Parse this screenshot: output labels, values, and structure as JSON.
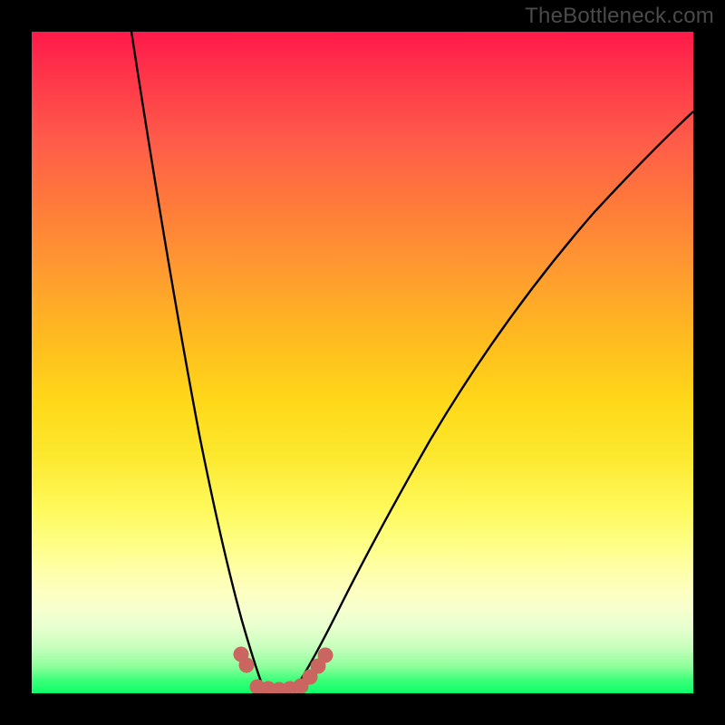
{
  "watermark": "TheBottleneck.com",
  "chart_data": {
    "type": "line",
    "title": "",
    "xlabel": "",
    "ylabel": "",
    "xlim": [
      0,
      100
    ],
    "ylim": [
      0,
      100
    ],
    "series": [
      {
        "name": "left-curve",
        "x": [
          15,
          17,
          19,
          21,
          23,
          25,
          27,
          29,
          31,
          33,
          34.5
        ],
        "values": [
          100,
          84,
          69,
          55,
          42,
          31,
          21,
          13,
          7,
          3,
          1
        ]
      },
      {
        "name": "right-curve",
        "x": [
          40,
          42,
          45,
          49,
          54,
          60,
          67,
          75,
          84,
          93,
          100
        ],
        "values": [
          1,
          3,
          7,
          13,
          21,
          31,
          42,
          55,
          69,
          80,
          88
        ]
      },
      {
        "name": "valley-flat",
        "x": [
          34.5,
          36,
          38,
          40
        ],
        "values": [
          1,
          0.5,
          0.5,
          1
        ]
      }
    ],
    "markers": [
      {
        "name": "left-marker-1",
        "x": 31.5,
        "y": 5.5
      },
      {
        "name": "left-marker-2",
        "x": 32.3,
        "y": 4.0
      },
      {
        "name": "bottom-marker-1",
        "x": 34.0,
        "y": 0.8
      },
      {
        "name": "bottom-marker-2",
        "x": 35.6,
        "y": 0.6
      },
      {
        "name": "bottom-marker-3",
        "x": 37.2,
        "y": 0.5
      },
      {
        "name": "bottom-marker-4",
        "x": 38.8,
        "y": 0.6
      },
      {
        "name": "bottom-marker-5",
        "x": 40.4,
        "y": 1.0
      },
      {
        "name": "right-marker-1",
        "x": 41.8,
        "y": 2.3
      },
      {
        "name": "right-marker-2",
        "x": 43.0,
        "y": 3.9
      },
      {
        "name": "right-marker-3",
        "x": 44.1,
        "y": 5.6
      }
    ],
    "marker_color": "#cb6560",
    "curve_color": "#000000"
  }
}
